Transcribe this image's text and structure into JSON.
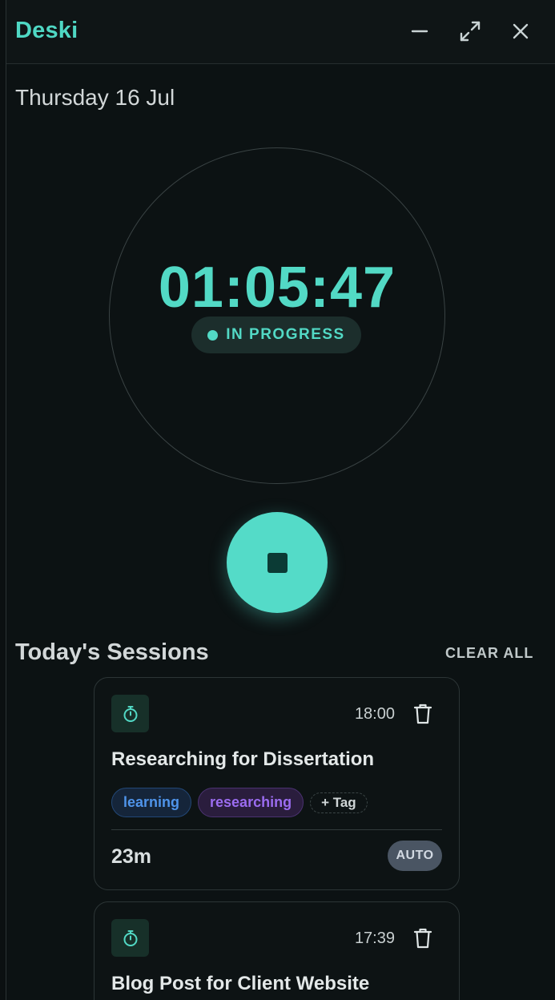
{
  "window": {
    "title": "Deski",
    "controls": {
      "minimize": "minimize-icon",
      "maximize": "expand-icon",
      "close": "close-icon"
    }
  },
  "header": {
    "date": "Thursday 16 Jul"
  },
  "timer": {
    "display": "01:05:47",
    "status": "IN PROGRESS",
    "accent_color": "#52d9c5",
    "stop_icon": "stop-icon"
  },
  "sessions": {
    "title": "Today's Sessions",
    "clear_all_label": "CLEAR ALL",
    "items": [
      {
        "icon": "stopwatch-icon",
        "time": "18:00",
        "title": "Researching for Dissertation",
        "tags": [
          "learning",
          "researching"
        ],
        "add_tag_label": "+ Tag",
        "duration": "23m",
        "badge": "AUTO"
      },
      {
        "icon": "stopwatch-icon",
        "time": "17:39",
        "title": "Blog Post for Client Website"
      }
    ]
  },
  "colors": {
    "background": "#0c1213",
    "accent": "#52d9c5",
    "tag_learning": "#4f94ea",
    "tag_researching": "#9b6cf0",
    "badge_auto_bg": "#4a5563"
  }
}
